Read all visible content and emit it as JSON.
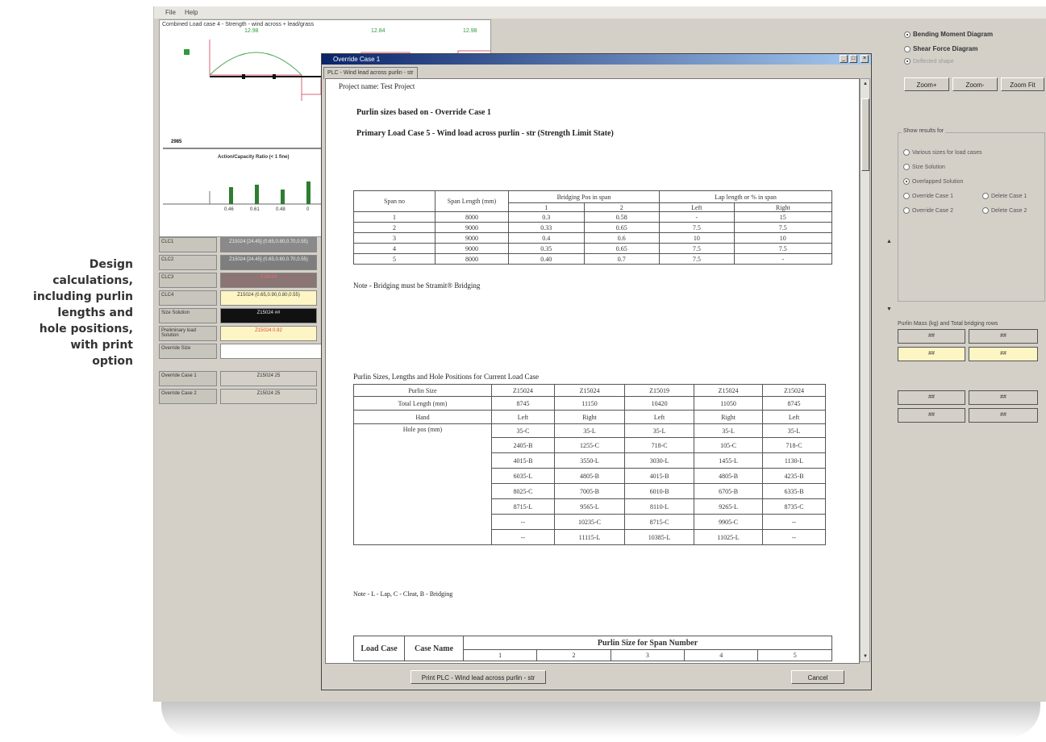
{
  "caption": [
    "Design",
    "calculations,",
    "including purlin",
    "lengths and",
    "hole positions,",
    "with print",
    "option"
  ],
  "menu": [
    "File",
    "Help"
  ],
  "chart": {
    "title": "Combined Load case 4 - Strength - wind across + lead/grass",
    "value_labels": [
      "12.98",
      "12.84",
      "12.98"
    ],
    "left_value": "2985",
    "ratio_title": "Action/Capacity Ratio (< 1 fine)",
    "ratio_ticks": [
      "0.46",
      "0.61",
      "0.48",
      "0"
    ]
  },
  "left_grid": [
    {
      "label": "CLC1",
      "value": "Z15024 [24.45] (0.65,0.80,0.70,0.55)"
    },
    {
      "label": "CLC2",
      "value": "Z15024 [24.45] (0.65,0.80,0.70,0.55)"
    },
    {
      "label": "CLC3",
      "value": "Z15024"
    },
    {
      "label": "CLC4",
      "value": "Z15024 (0.65,0.90,0.80,0.55)"
    },
    {
      "label": "Size Solution",
      "value": "Z15024 ##"
    },
    {
      "label": "Preliminary load Solution",
      "value": "Z15024 0.92"
    },
    {
      "label": "Override Size",
      "value": ""
    },
    {
      "label": "Override Case 1",
      "value": "Z15024 25"
    },
    {
      "label": "Override Case 2",
      "value": "Z15024 25"
    }
  ],
  "right_panel": {
    "diagram_options": [
      {
        "label": "Bending Moment Diagram",
        "checked": true
      },
      {
        "label": "Shear Force Diagram",
        "checked": false
      },
      {
        "label": "Deflected shape",
        "checked": true
      }
    ],
    "zoom_buttons": [
      "Zoom+",
      "Zoom-",
      "Zoom Fit"
    ],
    "show_results_title": "Show results for",
    "show_results": [
      {
        "label": "Various sizes for load cases",
        "on": false
      },
      {
        "label": "Size Solution",
        "on": false
      },
      {
        "label": "Overlapped Solution",
        "on": true
      },
      {
        "label": "Override Case 1",
        "on": false
      },
      {
        "label": "Delete Case 1",
        "on": false
      },
      {
        "label": "Override Case 2",
        "on": false
      },
      {
        "label": "Delete Case 2",
        "on": false
      }
    ],
    "mass_title": "Purlin Mass (kg) and Total bridging rows",
    "mass_cells": [
      "##",
      "##",
      "##",
      "##",
      "##",
      "##",
      "##",
      "##"
    ]
  },
  "dialog": {
    "title": "Override Case 1",
    "tab": "PLC - Wind lead across purlin - str",
    "print_button": "Print PLC - Wind lead across purlin - str",
    "cancel_button": "Cancel"
  },
  "doc": {
    "project": "Project name: Test Project",
    "heading1": "Purlin sizes based on - Override Case 1",
    "heading2": "Primary Load Case 5 - Wind load across purlin - str (Strength Limit State)",
    "span_table": {
      "headers": [
        "Span no",
        "Span Length (mm)",
        "Bridging Pos in span",
        "Lap length or % in span"
      ],
      "subheaders": [
        "1",
        "2",
        "Left",
        "Right"
      ],
      "rows": [
        [
          "1",
          "8000",
          "0.3",
          "0.58",
          "-",
          "15"
        ],
        [
          "2",
          "9000",
          "0.33",
          "0.65",
          "7.5",
          "7.5"
        ],
        [
          "3",
          "9000",
          "0.4",
          "0.6",
          "10",
          "10"
        ],
        [
          "4",
          "9000",
          "0.35",
          "0.65",
          "7.5",
          "7.5"
        ],
        [
          "5",
          "8000",
          "0.40",
          "0.7",
          "7.5",
          "-"
        ]
      ]
    },
    "note1": "Note - Bridging must be Stramit® Bridging",
    "sizes_title": "Purlin Sizes, Lengths and Hole Positions for Current Load Case",
    "sizes_table": {
      "row_labels": [
        "Purlin Size",
        "Total Length (mm)",
        "Hand",
        "Hole pos (mm)"
      ],
      "purlin_size": [
        "Z15024",
        "Z15024",
        "Z15019",
        "Z15024",
        "Z15024"
      ],
      "total_length": [
        "8745",
        "11150",
        "10420",
        "11050",
        "8745"
      ],
      "hand": [
        "Left",
        "Right",
        "Left",
        "Right",
        "Left"
      ],
      "holes": [
        [
          "35-C",
          "35-L",
          "35-L",
          "35-L",
          "35-L"
        ],
        [
          "2405-B",
          "1255-C",
          "718-C",
          "105-C",
          "718-C"
        ],
        [
          "4015-B",
          "3550-L",
          "3030-L",
          "1455-L",
          "1130-L"
        ],
        [
          "6035-L",
          "4805-B",
          "4015-B",
          "4805-B",
          "4235-B"
        ],
        [
          "8025-C",
          "7005-B",
          "6010-B",
          "6705-B",
          "6335-B"
        ],
        [
          "8715-L",
          "9565-L",
          "8110-L",
          "9265-L",
          "8735-C"
        ],
        [
          "--",
          "10235-C",
          "8715-C",
          "9905-C",
          "--"
        ],
        [
          "--",
          "11115-L",
          "10385-L",
          "11025-L",
          "--"
        ]
      ]
    },
    "note2": "Note - L - Lap, C - Cleat, B - Bridging",
    "bottom_table": {
      "headers": [
        "Load Case",
        "Case Name",
        "Purlin Size for Span Number"
      ],
      "span_numbers": [
        "1",
        "2",
        "3",
        "4",
        "5"
      ]
    }
  }
}
